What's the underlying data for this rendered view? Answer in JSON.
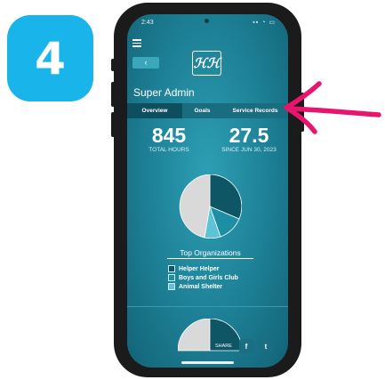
{
  "step": {
    "number": "4"
  },
  "status_bar": {
    "time": "2:43",
    "system_icons": "signal-wifi-battery"
  },
  "nav": {
    "menu_icon": "hamburger-menu-icon",
    "back_label": "‹"
  },
  "logo": {
    "text": "ℋℋ"
  },
  "page": {
    "title": "Super Admin"
  },
  "tabs": [
    {
      "label": "Overview",
      "active": true
    },
    {
      "label": "Goals",
      "active": false
    },
    {
      "label": "Service Records",
      "active": false
    }
  ],
  "stats": [
    {
      "value": "845",
      "label": "TOTAL HOURS"
    },
    {
      "value": "27.5",
      "label": "SINCE JUN 30, 2023"
    }
  ],
  "organizations": {
    "title": "Top Organizations",
    "items": [
      {
        "name": "Helper Helper",
        "color": "#0e5666"
      },
      {
        "name": "Boys and Girls Club",
        "color": "#1d8fa5"
      },
      {
        "name": "Animal Shelter",
        "color": "#5cc4d6"
      }
    ],
    "other_color": "#d9d9d9"
  },
  "share": {
    "label": "SHARE",
    "facebook_icon": "f",
    "twitter_icon": "t"
  },
  "annotation": {
    "arrow_color": "#e8146d"
  }
}
